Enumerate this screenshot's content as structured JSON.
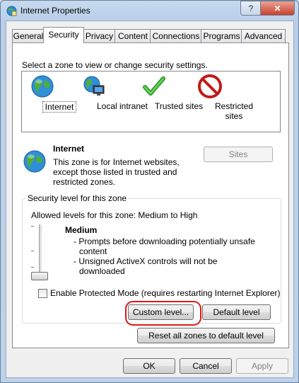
{
  "window": {
    "title": "Internet Properties",
    "help_label": "?",
    "close_label": "✕"
  },
  "tabs": [
    {
      "label": "General",
      "active": false
    },
    {
      "label": "Security",
      "active": true
    },
    {
      "label": "Privacy",
      "active": false
    },
    {
      "label": "Content",
      "active": false
    },
    {
      "label": "Connections",
      "active": false
    },
    {
      "label": "Programs",
      "active": false
    },
    {
      "label": "Advanced",
      "active": false
    }
  ],
  "security": {
    "zone_prompt": "Select a zone to view or change security settings.",
    "zones": [
      {
        "label": "Internet",
        "icon": "globe-icon",
        "selected": true
      },
      {
        "label": "Local intranet",
        "icon": "intranet-icon",
        "selected": false
      },
      {
        "label": "Trusted sites",
        "icon": "checkmark-icon",
        "selected": false
      },
      {
        "label": "Restricted sites",
        "icon": "no-entry-icon",
        "selected": false
      }
    ],
    "selected_zone": {
      "title": "Internet",
      "description": "This zone is for Internet websites, except those listed in trusted and restricted zones."
    },
    "sites_button": "Sites",
    "level_group_title": "Security level for this zone",
    "allowed_levels": "Allowed levels for this zone: Medium to High",
    "level_name": "Medium",
    "level_points": [
      "- Prompts before downloading potentially unsafe content",
      "- Unsigned ActiveX controls will not be downloaded"
    ],
    "protected_mode_label": "Enable Protected Mode (requires restarting Internet Explorer)",
    "protected_mode_checked": false,
    "custom_level_button": "Custom level...",
    "default_level_button": "Default level",
    "reset_button": "Reset all zones to default level"
  },
  "footer": {
    "ok": "OK",
    "cancel": "Cancel",
    "apply": "Apply"
  },
  "colors": {
    "highlight": "#d81919",
    "frame": "#bcd2ea",
    "face": "#f0f0f0"
  }
}
